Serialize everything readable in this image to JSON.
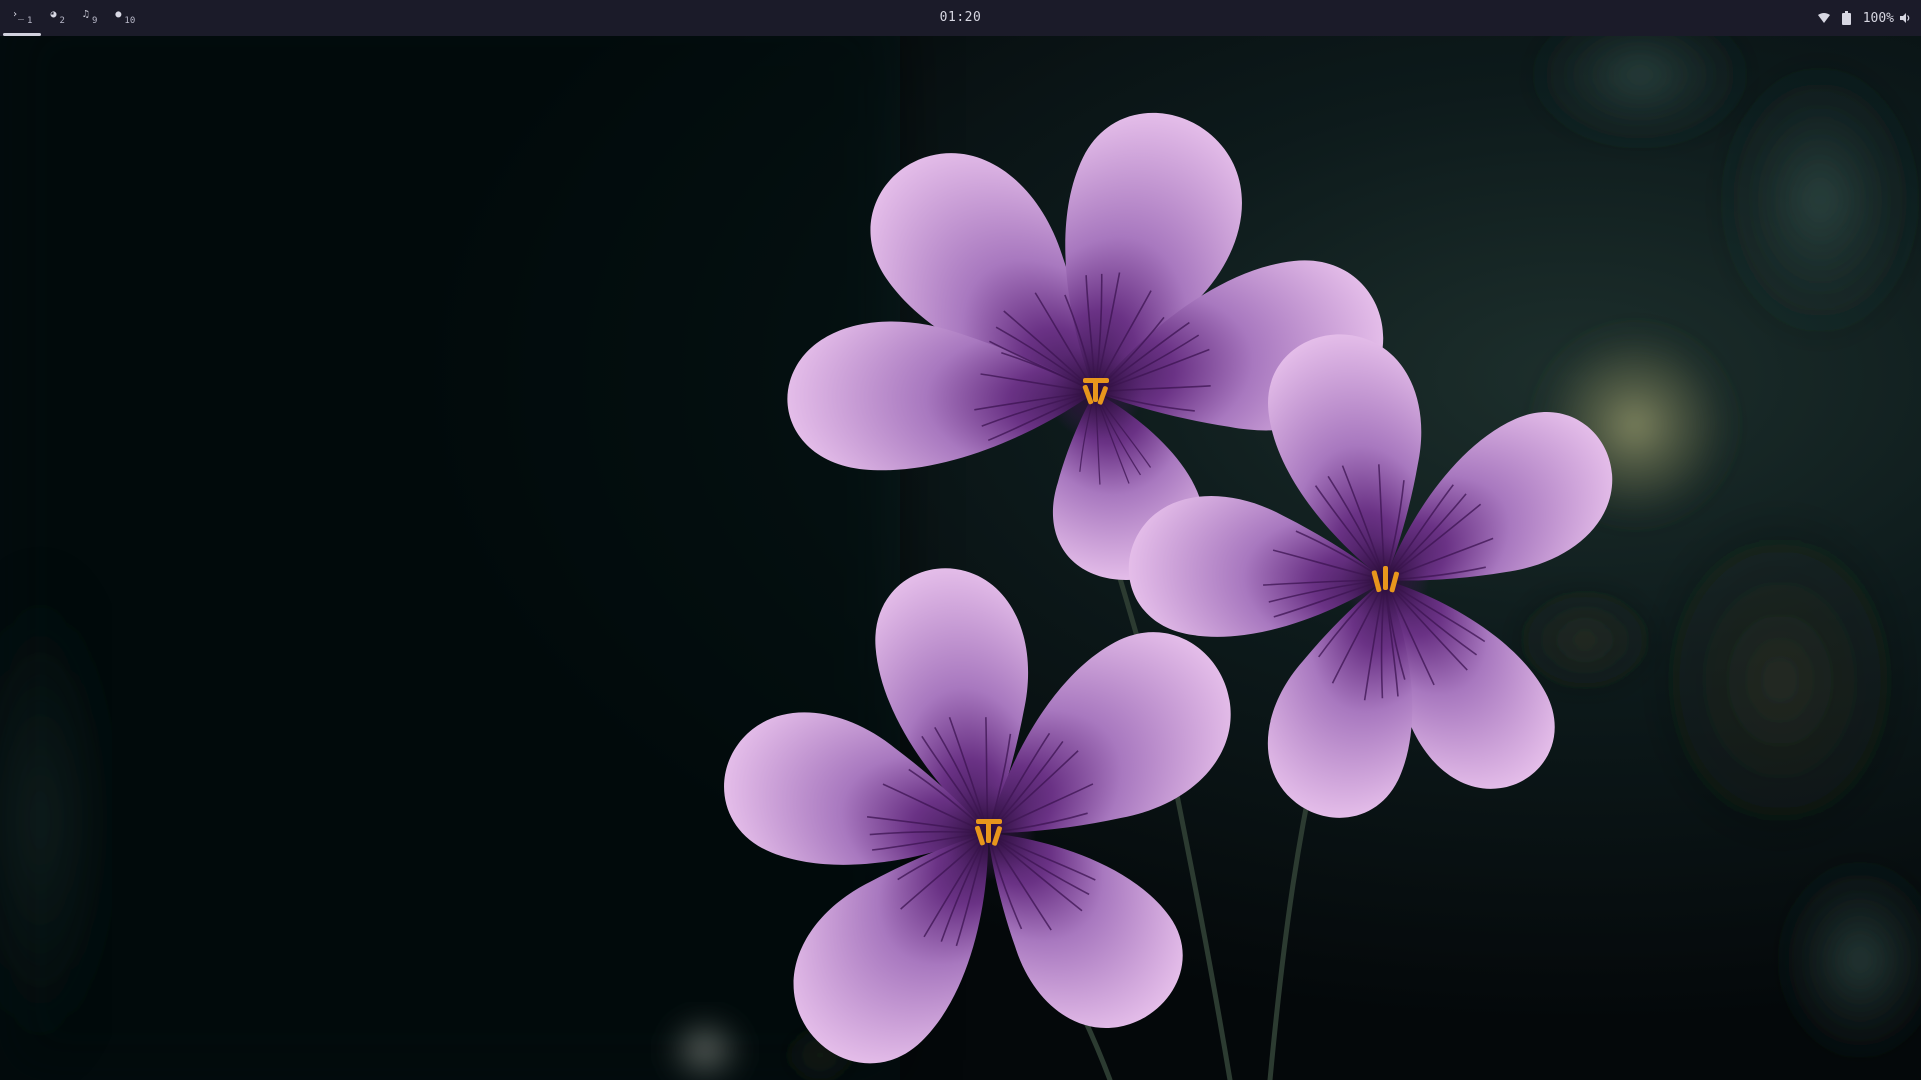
{
  "topbar": {
    "workspaces": [
      {
        "icon": "terminal-icon",
        "glyph": "›_",
        "number": "1",
        "active": true
      },
      {
        "icon": "firefox-icon",
        "glyph": "◕",
        "number": "2",
        "active": false
      },
      {
        "icon": "music-note-icon",
        "glyph": "♫",
        "number": "9",
        "active": false
      },
      {
        "icon": "chat-bubble-icon",
        "glyph": "●",
        "number": "10",
        "active": false
      }
    ],
    "clock": "01:20",
    "tray": {
      "wifi_icon": "wifi-icon",
      "battery_icon": "battery-icon",
      "volume_level": "100%",
      "volume_icon": "speaker-icon"
    }
  },
  "wallpaper": {
    "subject": "three purple flowers on dark background",
    "colors": {
      "background": "#05090c",
      "petal": "#b67fc8",
      "petal_light": "#e2b8e6",
      "petal_dark": "#4a1e64",
      "stamen": "#e29818",
      "bokeh": "#8a8c58"
    }
  }
}
